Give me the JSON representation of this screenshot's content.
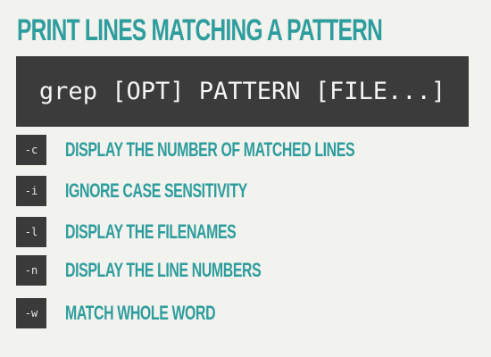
{
  "title": "PRINT LINES MATCHING A PATTERN",
  "command": "grep [OPT] PATTERN [FILE...]",
  "options": [
    {
      "flag": "-c",
      "description": "DISPLAY THE NUMBER OF MATCHED LINES"
    },
    {
      "flag": "-i",
      "description": "IGNORE CASE SENSITIVITY"
    },
    {
      "flag": "-l",
      "description": "DISPLAY THE FILENAMES"
    },
    {
      "flag": "-n",
      "description": "DISPLAY THE LINE NUMBERS"
    },
    {
      "flag": "-w",
      "description": "MATCH WHOLE WORD"
    }
  ],
  "colors": {
    "background": "#f2f2ee",
    "accent": "#2e9d9d",
    "dark_box": "#3b3b3b",
    "box_text": "#f4f4f4"
  }
}
